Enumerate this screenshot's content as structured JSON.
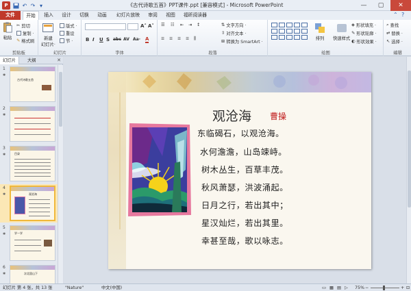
{
  "window": {
    "title": "《古代诗歌五首》PPT课件.ppt [兼容模式] - Microsoft PowerPoint",
    "controls": {
      "minimize": "—",
      "maximize": "▢",
      "close": "✕"
    }
  },
  "quick_access": {
    "logo": "P",
    "save_icon": "save-icon",
    "undo_icon": "undo-icon",
    "redo_icon": "redo-icon"
  },
  "tabs": [
    {
      "label": "文件"
    },
    {
      "label": "开始"
    },
    {
      "label": "插入"
    },
    {
      "label": "设计"
    },
    {
      "label": "切换"
    },
    {
      "label": "动画"
    },
    {
      "label": "幻灯片放映"
    },
    {
      "label": "审阅"
    },
    {
      "label": "视图"
    },
    {
      "label": "福昕阅读器"
    }
  ],
  "ribbon": {
    "clipboard": {
      "paste": "粘贴",
      "cut": "剪切",
      "copy": "复制 ·",
      "format_painter": "格式刷",
      "label": "剪贴板"
    },
    "slides": {
      "new_slide": "新建\n幻灯片·",
      "layout": "版式 ·",
      "reset": "重设",
      "section": "节 ·",
      "label": "幻灯片"
    },
    "font": {
      "font_name": "",
      "font_size": "",
      "bold": "B",
      "italic": "I",
      "underline": "U",
      "strike": "S",
      "abc": "abc",
      "spacing": "AV",
      "case": "Aa·",
      "color": "A",
      "grow": "A˄",
      "shrink": "A˅",
      "clear": "A",
      "label": "字体"
    },
    "paragraph": {
      "text_direction": "文字方向 ·",
      "align_text": "对齐文本 ·",
      "smartart": "转换为 SmartArt ·",
      "label": "段落"
    },
    "drawing": {
      "arrange": "排列",
      "quick_styles": "快速样式",
      "shape_fill": "形状填充 ·",
      "shape_outline": "形状轮廓 ·",
      "shape_effects": "形状效果 ·",
      "label": "绘图"
    },
    "editing": {
      "find": "查找",
      "replace": "替换 ·",
      "select": "选择 ·",
      "label": "编辑"
    }
  },
  "left_panel": {
    "tabs": [
      {
        "label": "幻灯片"
      },
      {
        "label": "大纲"
      }
    ],
    "close": "✕",
    "slides": [
      {
        "num": "1",
        "title": "古代诗歌五首"
      },
      {
        "num": "2",
        "title": ""
      },
      {
        "num": "3",
        "title": "目录"
      },
      {
        "num": "4",
        "title": "观沧海"
      },
      {
        "num": "5",
        "title": "学一学"
      },
      {
        "num": "6",
        "title": "次北固山下"
      }
    ]
  },
  "slide": {
    "title": "观沧海",
    "author": "曹操",
    "lines": [
      "东临碣石，以观沧海。",
      "水何澹澹，山岛竦峙。",
      "树木丛生，百草丰茂。",
      "秋风萧瑟，洪波涌起。",
      "日月之行，若出其中；",
      "星汉灿烂，若出其里。",
      "幸甚至哉，歌以咏志。"
    ]
  },
  "status_bar": {
    "slide_info": "幻灯片 第 4 张，共 13 张",
    "theme": "\"Nature\"",
    "language": "中文(中国)",
    "zoom": "75%"
  },
  "colors": {
    "accent": "#c0392b",
    "title_red": "#c01a1a",
    "ribbon_bg": "#e9eef5"
  }
}
